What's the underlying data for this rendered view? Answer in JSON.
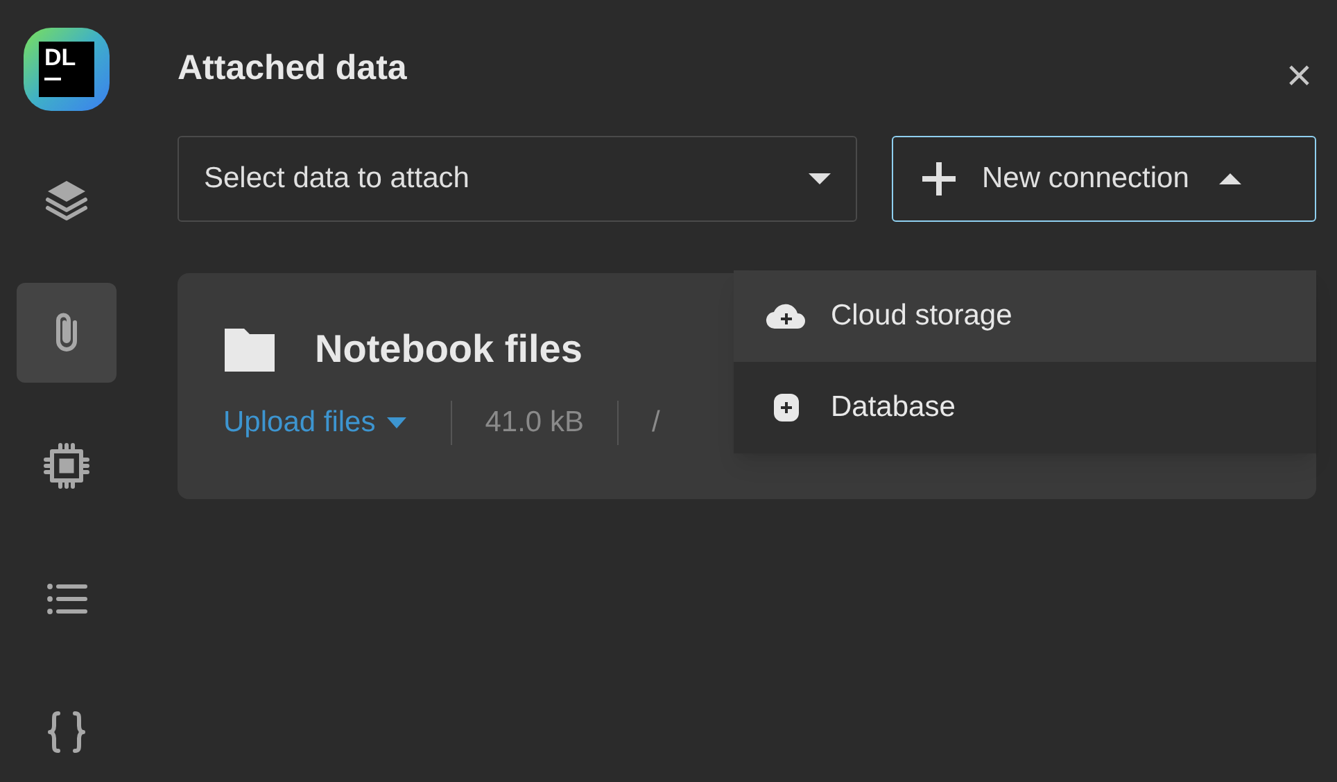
{
  "sidebar": {
    "items": [
      {
        "kind": "layers",
        "selected": false
      },
      {
        "kind": "attachment",
        "selected": true
      },
      {
        "kind": "chip",
        "selected": false
      },
      {
        "kind": "list",
        "selected": false
      },
      {
        "kind": "braces",
        "selected": false
      }
    ]
  },
  "logo": {
    "text": "DL"
  },
  "header": {
    "title": "Attached data",
    "close": "×"
  },
  "select": {
    "placeholder": "Select data to attach"
  },
  "new_connection": {
    "label": "New connection",
    "expanded": true,
    "menu": [
      {
        "label": "Cloud storage",
        "kind": "cloud",
        "selected": true
      },
      {
        "label": "Database",
        "kind": "database",
        "selected": false
      }
    ]
  },
  "card": {
    "title": "Notebook files",
    "upload": "Upload files",
    "size": "41.0 kB",
    "path": "/"
  }
}
